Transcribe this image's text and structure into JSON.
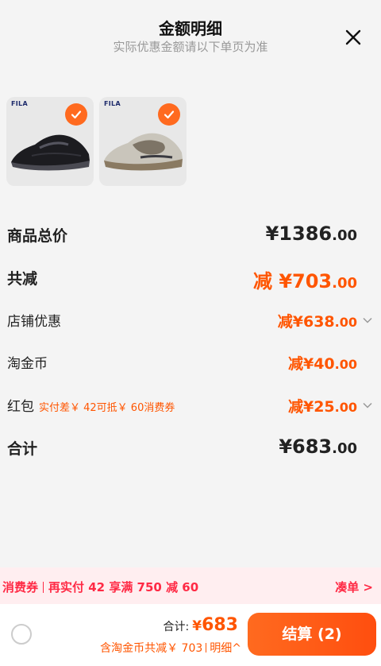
{
  "header": {
    "title": "金额明细",
    "subtitle": "实际优惠金额请以下单页为准"
  },
  "products": [
    {
      "brand": "FILA",
      "color": "black"
    },
    {
      "brand": "FILA",
      "color": "grey-beige"
    }
  ],
  "summary": {
    "total_label": "商品总价",
    "total_int": "¥1386",
    "total_dec": ".00",
    "discount_label": "共减",
    "discount_prefix": "减",
    "discount_int": "¥703",
    "discount_dec": ".00",
    "shop_label": "店铺优惠",
    "shop_prefix": "减",
    "shop_int": "¥638",
    "shop_dec": ".00",
    "coin_label": "淘金币",
    "coin_prefix": "减",
    "coin_int": "¥40",
    "coin_dec": ".00",
    "redpacket_label": "红包",
    "redpacket_hint": "实付差￥ 42可抵￥ 60消费券",
    "redpacket_prefix": "减",
    "redpacket_int": "¥25",
    "redpacket_dec": ".00",
    "final_label": "合计",
    "final_int": "¥683",
    "final_dec": ".00"
  },
  "promo": {
    "tag": "消费券",
    "text": "再实付 42 享满 750 减 60",
    "link": "凑单 >"
  },
  "footer": {
    "sum_label": "合计:",
    "sum_currency": "¥",
    "sum_value": "683",
    "sub_text": "含淘金币共减￥ 703",
    "detail_link": "明细^",
    "pay_button": "结算 (2)"
  },
  "colors": {
    "accent": "#ff5500",
    "promo_red": "#ff2a45",
    "promo_bg": "#ffeef0"
  }
}
